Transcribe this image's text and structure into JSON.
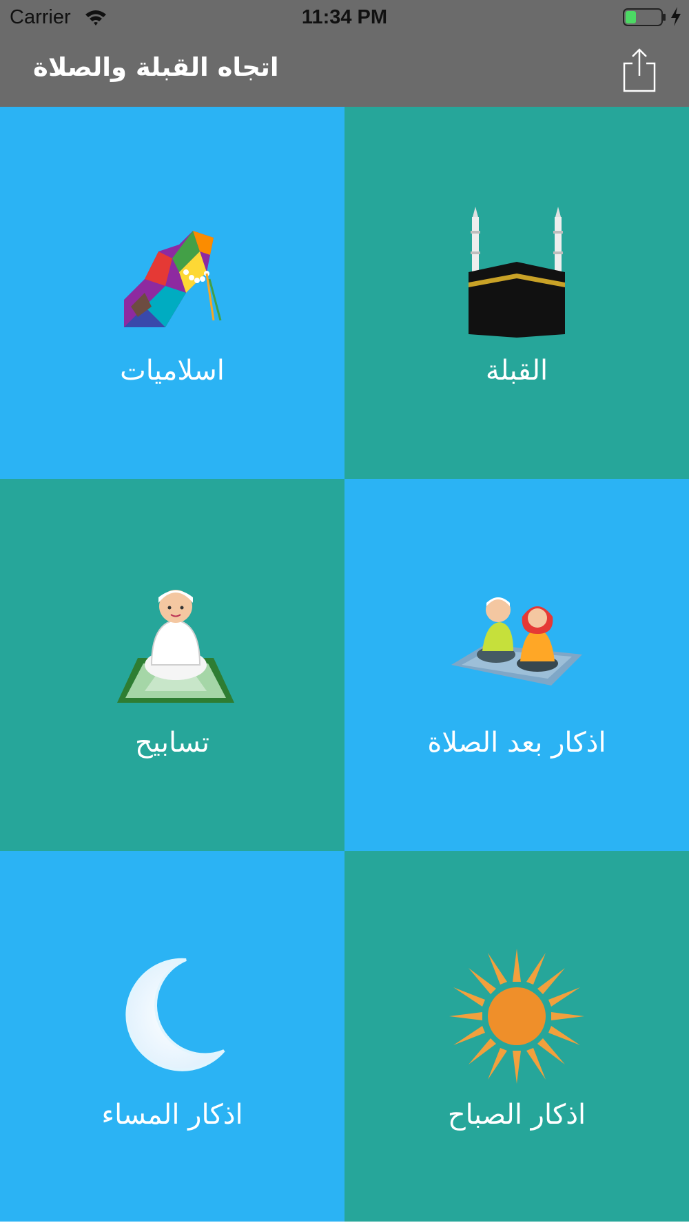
{
  "status_bar": {
    "carrier": "Carrier",
    "time": "11:34 PM",
    "battery_color": "#4cd964"
  },
  "nav": {
    "title": "اتجاه القبلة والصلاة",
    "share_icon": "share-icon"
  },
  "colors": {
    "blue_tile": "#2bb3f4",
    "teal_tile": "#26a69a",
    "bar": "#6b6b6b"
  },
  "tiles": [
    {
      "label": "اسلاميات",
      "icon": "praying-hands-icon"
    },
    {
      "label": "القبلة",
      "icon": "kaaba-icon"
    },
    {
      "label": "تسابيح",
      "icon": "praying-child-icon"
    },
    {
      "label": "اذكار بعد الصلاة",
      "icon": "praying-children-icon"
    },
    {
      "label": "اذكار المساء",
      "icon": "crescent-moon-icon"
    },
    {
      "label": "اذكار الصباح",
      "icon": "sun-icon"
    }
  ]
}
